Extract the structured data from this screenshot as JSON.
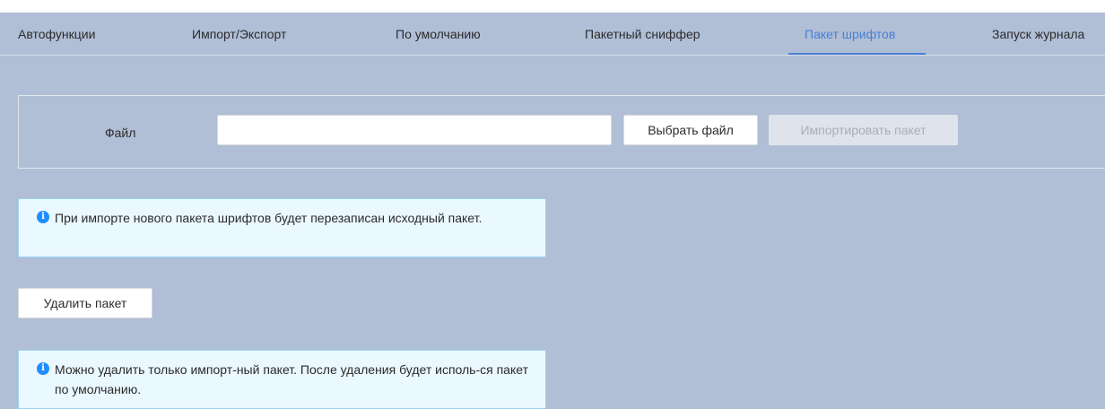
{
  "tabs": [
    {
      "label": "Автофункции"
    },
    {
      "label": "Импорт/Экспорт"
    },
    {
      "label": "По умолчанию"
    },
    {
      "label": "Пакетный сниффер"
    },
    {
      "label": "Пакет шрифтов",
      "active": true
    },
    {
      "label": "Запуск журнала"
    }
  ],
  "import_form": {
    "file_label": "Файл",
    "file_value": "",
    "choose_button": "Выбрать файл",
    "import_button": "Импортировать пакет"
  },
  "notice_import": {
    "icon": "info-icon",
    "text": "При импорте нового пакета шрифтов будет перезаписан исходный пакет."
  },
  "delete_button": "Удалить пакет",
  "notice_delete": {
    "icon": "info-icon",
    "text": "Можно удалить только импорт-ный пакет. После удаления будет исполь-ся пакет по умолчанию."
  },
  "colors": {
    "background": "#b0bed6",
    "accent": "#4a7fd1",
    "notice_bg": "#eaf8ff",
    "notice_border": "#9ad4f5",
    "info_icon": "#1f8eff"
  }
}
